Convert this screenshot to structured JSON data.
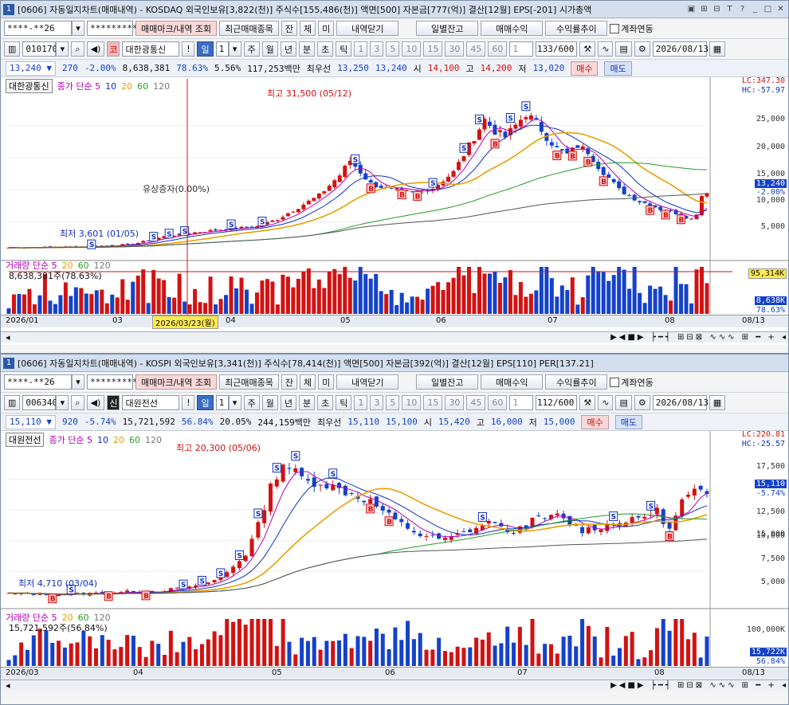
{
  "w1": {
    "title": "[0606] 자동일지차트(매매내역) - KOSDAQ 외국인보유[3,822(천)] 주식수[155,486(천)] 액면[500] 자본금[777(억)] 결산[12월] EPS[-201] 시가총액",
    "account": "****-**26",
    "password": "*********",
    "btn_markview": "매매마크/내역 조회",
    "btn_recent": "최근매매종목",
    "btn_jan": "잔",
    "btn_che": "체",
    "btn_mi": "미",
    "btn_close_hist": "내역닫기",
    "btn_daily": "일별잔고",
    "btn_profit": "매매수익",
    "btn_rate": "수익률추이",
    "chk_link": "계좌연동",
    "code": "010170",
    "market_badge": "코",
    "stock_name": "대한광통신",
    "period_il": "일",
    "period_num": "1",
    "periods": [
      "주",
      "월",
      "년",
      "분",
      "초",
      "틱"
    ],
    "nums": [
      "1",
      "3",
      "5",
      "10",
      "15",
      "30",
      "45",
      "60"
    ],
    "num_sel": "1",
    "count": "133/600",
    "date": "2026/08/13",
    "q_price": "13,240",
    "q_change": "270",
    "q_rate": "-2.00%",
    "q_volume": "8,638,381",
    "q_volrate": "78.63%",
    "q_turnover": "5.56%",
    "q_amount": "117,253백만",
    "q_bid_label": "최우선",
    "q_bid1": "13,250",
    "q_bid2": "13,240",
    "q_open_label": "시",
    "q_open": "14,100",
    "q_high_label": "고",
    "q_high": "14,200",
    "q_low_label": "저",
    "q_low": "13,020",
    "buy": "매수",
    "sell": "매도",
    "legend_name": "대한광통신",
    "legend_ma": "종가 단순 5",
    "ma_periods": [
      "10",
      "20",
      "60",
      "120"
    ],
    "high_note": "최고 31,500 (05/12)",
    "low_note": "최저 3,601 (01/05)",
    "event_note": "유상증자(0.00%)",
    "lc": "LC:347.30",
    "hc": "HC:-57.97",
    "yticks": [
      "25,000",
      "20,000",
      "15,000",
      "10,000",
      "5,000"
    ],
    "price_tag": "13,240",
    "price_tag_rate": "-2.00%",
    "vol_legend": "거래량  단순 5",
    "vol_ma": [
      "20",
      "60",
      "120"
    ],
    "vol_note": "8,638,381주(78.63%)",
    "vol_tag1": "95,314K",
    "vol_tag2": "8,638K",
    "vol_tag3": "78.63%",
    "dates": [
      "2026/01",
      "03",
      "04",
      "05",
      "06",
      "07",
      "08"
    ],
    "date_cursor": "2026/03/23(월)",
    "date_end": "08/13"
  },
  "w2": {
    "title": "[0606] 자동일지차트(매매내역) - KOSPI 외국인보유[3,341(천)] 주식수[78,414(천)] 액면[500] 자본금[392(억)] 결산[12월] EPS[110] PER[137.21]",
    "account": "****-**26",
    "password": "*********",
    "btn_markview": "매매마크/내역 조회",
    "btn_recent": "최근매매종목",
    "btn_jan": "잔",
    "btn_che": "체",
    "btn_mi": "미",
    "btn_close_hist": "내역닫기",
    "btn_daily": "일별잔고",
    "btn_profit": "매매수익",
    "btn_rate": "수익률추이",
    "chk_link": "계좌연동",
    "code": "006340",
    "market_badge": "신",
    "stock_name": "대원전선",
    "period_il": "일",
    "period_num": "1",
    "periods": [
      "주",
      "월",
      "년",
      "분",
      "초",
      "틱"
    ],
    "nums": [
      "1",
      "3",
      "5",
      "10",
      "15",
      "30",
      "45",
      "60"
    ],
    "num_sel": "1",
    "count": "112/600",
    "date": "2026/08/13",
    "q_price": "15,110",
    "q_change": "920",
    "q_rate": "-5.74%",
    "q_volume": "15,721,592",
    "q_volrate": "56.84%",
    "q_turnover": "20.05%",
    "q_amount": "244,159백만",
    "q_bid_label": "최우선",
    "q_bid1": "15,110",
    "q_bid2": "15,100",
    "q_open_label": "시",
    "q_open": "15,420",
    "q_high_label": "고",
    "q_high": "16,000",
    "q_low_label": "저",
    "q_low": "15,000",
    "buy": "매수",
    "sell": "매도",
    "legend_name": "대원전선",
    "legend_ma": "종가 단순 5",
    "ma_periods": [
      "10",
      "20",
      "60",
      "120"
    ],
    "high_note": "최고 20,300 (05/06)",
    "low_note": "최저 4,710 (03/04)",
    "lc": "LC:220.81",
    "hc": "HC:-25.57",
    "yticks": [
      "17,500",
      "15,000",
      "12,500",
      "10,000",
      "7,500",
      "5,000"
    ],
    "price_tag": "15,110",
    "price_tag_rate": "-5.74%",
    "vol_legend": "거래량  단순 5",
    "vol_ma": [
      "20",
      "60",
      "120"
    ],
    "vol_note": "15,721,592주(56.84%)",
    "vol_tag1": "100,000K",
    "vol_tag2": "15,722K",
    "vol_tag3": "56.84%",
    "dates": [
      "2026/03",
      "04",
      "05",
      "06",
      "07",
      "08"
    ],
    "date_end": "08/13"
  },
  "colors": {
    "up": "#d21212",
    "down": "#1442c9",
    "ma5": "#b000b0",
    "ma10": "#1030c0",
    "ma20": "#e8a000",
    "ma60": "#2a9a2a",
    "ma120": "#555555"
  },
  "chart_data": [
    {
      "type": "candlestick",
      "title": "대한광통신",
      "x_range": [
        "2026/01",
        "2026/08/13"
      ],
      "ylim": [
        2500,
        30000
      ],
      "high": {
        "value": 31500,
        "date": "05/12"
      },
      "low": {
        "value": 3601,
        "date": "01/05"
      },
      "close_path": [
        [
          0,
          3600
        ],
        [
          8,
          3700
        ],
        [
          16,
          3800
        ],
        [
          24,
          4200
        ],
        [
          30,
          5500
        ],
        [
          36,
          6200
        ],
        [
          42,
          6800
        ],
        [
          48,
          7200
        ],
        [
          52,
          8500
        ],
        [
          56,
          10500
        ],
        [
          60,
          12500
        ],
        [
          64,
          16000
        ],
        [
          66,
          18500
        ],
        [
          70,
          14500
        ],
        [
          74,
          13500
        ],
        [
          78,
          13000
        ],
        [
          82,
          13800
        ],
        [
          86,
          16500
        ],
        [
          88,
          19500
        ],
        [
          90,
          22500
        ],
        [
          92,
          25500
        ],
        [
          94,
          23500
        ],
        [
          96,
          22500
        ],
        [
          98,
          24500
        ],
        [
          100,
          26500
        ],
        [
          102,
          25000
        ],
        [
          104,
          22500
        ],
        [
          106,
          20500
        ],
        [
          108,
          19500
        ],
        [
          110,
          21000
        ],
        [
          112,
          20000
        ],
        [
          114,
          17500
        ],
        [
          116,
          15500
        ],
        [
          118,
          13500
        ],
        [
          120,
          12500
        ],
        [
          122,
          11500
        ],
        [
          124,
          11000
        ],
        [
          126,
          10200
        ],
        [
          128,
          9800
        ],
        [
          130,
          9200
        ],
        [
          132,
          8500
        ],
        [
          133,
          9500
        ],
        [
          134,
          12500
        ],
        [
          135,
          13240
        ]
      ]
    },
    {
      "type": "candlestick",
      "title": "대원전선",
      "x_range": [
        "2026/03",
        "2026/08/13"
      ],
      "ylim": [
        4000,
        20000
      ],
      "high": {
        "value": 20300,
        "date": "05/06"
      },
      "low": {
        "value": 4710,
        "date": "03/04"
      },
      "close_path": [
        [
          0,
          4900
        ],
        [
          8,
          4800
        ],
        [
          16,
          5000
        ],
        [
          24,
          5200
        ],
        [
          30,
          5600
        ],
        [
          34,
          6500
        ],
        [
          38,
          9000
        ],
        [
          40,
          12000
        ],
        [
          42,
          16000
        ],
        [
          44,
          18500
        ],
        [
          46,
          17500
        ],
        [
          48,
          16500
        ],
        [
          50,
          16500
        ],
        [
          54,
          15500
        ],
        [
          58,
          14500
        ],
        [
          62,
          12500
        ],
        [
          66,
          11000
        ],
        [
          70,
          10500
        ],
        [
          74,
          11500
        ],
        [
          78,
          12500
        ],
        [
          80,
          11000
        ],
        [
          84,
          12500
        ],
        [
          88,
          13000
        ],
        [
          92,
          11500
        ],
        [
          96,
          12000
        ],
        [
          100,
          12500
        ],
        [
          104,
          13500
        ],
        [
          106,
          11500
        ],
        [
          108,
          14500
        ],
        [
          110,
          15500
        ],
        [
          112,
          15110
        ]
      ]
    }
  ]
}
